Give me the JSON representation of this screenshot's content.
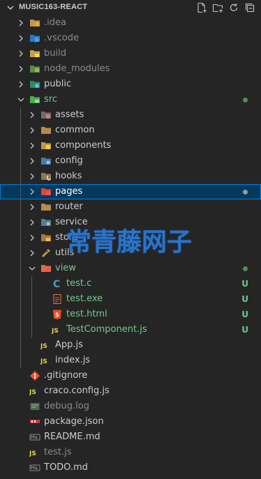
{
  "explorer": {
    "title": "MUSIC163-REACT",
    "actions": [
      "new-file-icon",
      "new-folder-icon",
      "refresh-icon",
      "collapse-all-icon"
    ]
  },
  "items": [
    {
      "label": "idea-folder",
      "text": ".idea",
      "type": "folder",
      "depth": 0,
      "open": false,
      "icon": "idea-folder-icon",
      "color": "#8b8b8b"
    },
    {
      "label": "vscode-folder",
      "text": ".vscode",
      "type": "folder",
      "depth": 0,
      "open": false,
      "icon": "vscode-folder-icon",
      "color": "#8b8b8b"
    },
    {
      "label": "build-folder",
      "text": "build",
      "type": "folder",
      "depth": 0,
      "open": false,
      "icon": "build-folder-icon",
      "color": "#8b8b8b"
    },
    {
      "label": "node-modules-folder",
      "text": "node_modules",
      "type": "folder",
      "depth": 0,
      "open": false,
      "icon": "node-folder-icon",
      "color": "#8b8b8b"
    },
    {
      "label": "public-folder",
      "text": "public",
      "type": "folder",
      "depth": 0,
      "open": false,
      "icon": "public-folder-icon",
      "color": "#cccccc"
    },
    {
      "label": "src-folder",
      "text": "src",
      "type": "folder",
      "depth": 0,
      "open": true,
      "icon": "src-folder-icon",
      "color": "#73c991",
      "dot": "#4c8f5a"
    },
    {
      "label": "assets-folder",
      "text": "assets",
      "type": "folder",
      "depth": 1,
      "open": false,
      "icon": "assets-folder-icon",
      "color": "#cccccc"
    },
    {
      "label": "common-folder",
      "text": "common",
      "type": "folder",
      "depth": 1,
      "open": false,
      "icon": "folder-icon",
      "color": "#cccccc"
    },
    {
      "label": "components-folder",
      "text": "components",
      "type": "folder",
      "depth": 1,
      "open": false,
      "icon": "components-folder-icon",
      "color": "#cccccc"
    },
    {
      "label": "config-folder",
      "text": "config",
      "type": "folder",
      "depth": 1,
      "open": false,
      "icon": "config-folder-icon",
      "color": "#cccccc"
    },
    {
      "label": "hooks-folder",
      "text": "hooks",
      "type": "folder",
      "depth": 1,
      "open": false,
      "icon": "hooks-folder-icon",
      "color": "#cccccc"
    },
    {
      "label": "pages-folder",
      "text": "pages",
      "type": "folder",
      "depth": 1,
      "open": false,
      "icon": "pages-folder-icon",
      "color": "#ffffff",
      "selected": true,
      "dot": "#9a9a9a"
    },
    {
      "label": "router-folder",
      "text": "router",
      "type": "folder",
      "depth": 1,
      "open": false,
      "icon": "folder-icon",
      "color": "#cccccc"
    },
    {
      "label": "service-folder",
      "text": "service",
      "type": "folder",
      "depth": 1,
      "open": false,
      "icon": "service-folder-icon",
      "color": "#cccccc"
    },
    {
      "label": "store-folder",
      "text": "store",
      "type": "folder",
      "depth": 1,
      "open": false,
      "icon": "store-folder-icon",
      "color": "#cccccc"
    },
    {
      "label": "utils-folder",
      "text": "utils",
      "type": "folder",
      "depth": 1,
      "open": false,
      "icon": "utils-folder-icon",
      "color": "#cccccc"
    },
    {
      "label": "view-folder",
      "text": "view",
      "type": "folder",
      "depth": 1,
      "open": true,
      "icon": "view-folder-icon",
      "color": "#73c991",
      "dot": "#4c8f5a"
    },
    {
      "label": "test-c-file",
      "text": "test.c",
      "type": "file",
      "depth": 2,
      "icon": "c-file-icon",
      "color": "#73c991",
      "badge": "U"
    },
    {
      "label": "test-exe-file",
      "text": "test.exe",
      "type": "file",
      "depth": 2,
      "icon": "exe-file-icon",
      "color": "#73c991",
      "badge": "U"
    },
    {
      "label": "test-html-file",
      "text": "test.html",
      "type": "file",
      "depth": 2,
      "icon": "html-file-icon",
      "color": "#73c991",
      "badge": "U"
    },
    {
      "label": "testcomponent-js-file",
      "text": "TestComponent.js",
      "type": "file",
      "depth": 2,
      "icon": "js-file-icon",
      "color": "#73c991",
      "badge": "U"
    },
    {
      "label": "app-js-file",
      "text": "App.js",
      "type": "file",
      "depth": 1,
      "icon": "js-file-icon",
      "color": "#cccccc"
    },
    {
      "label": "index-js-file",
      "text": "index.js",
      "type": "file",
      "depth": 1,
      "icon": "js-file-icon",
      "color": "#cccccc"
    },
    {
      "label": "gitignore-file",
      "text": ".gitignore",
      "type": "file",
      "depth": 0,
      "icon": "git-file-icon",
      "color": "#cccccc"
    },
    {
      "label": "craco-config-file",
      "text": "craco.config.js",
      "type": "file",
      "depth": 0,
      "icon": "js-file-icon",
      "color": "#cccccc"
    },
    {
      "label": "debug-log-file",
      "text": "debug.log",
      "type": "file",
      "depth": 0,
      "icon": "log-file-icon",
      "color": "#8b8b8b"
    },
    {
      "label": "package-json-file",
      "text": "package.json",
      "type": "file",
      "depth": 0,
      "icon": "npm-file-icon",
      "color": "#cccccc"
    },
    {
      "label": "readme-file",
      "text": "README.md",
      "type": "file",
      "depth": 0,
      "icon": "markdown-file-icon",
      "color": "#cccccc"
    },
    {
      "label": "test-js-file",
      "text": "test.js",
      "type": "file",
      "depth": 0,
      "icon": "js-file-icon",
      "color": "#8b8b8b"
    },
    {
      "label": "todo-file",
      "text": "TODO.md",
      "type": "file",
      "depth": 0,
      "icon": "markdown-file-icon",
      "color": "#cccccc"
    }
  ],
  "watermark": "常青藤网子"
}
